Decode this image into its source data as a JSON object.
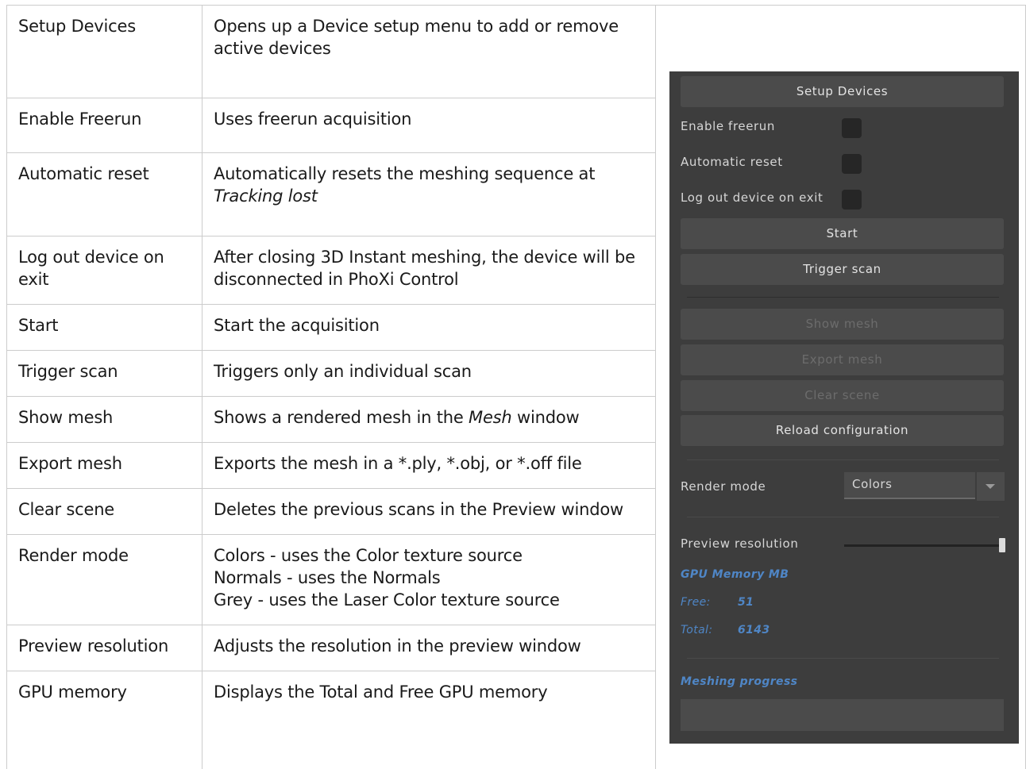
{
  "table": {
    "rows": [
      {
        "name": "Setup Devices",
        "desc": [
          "Opens up a Device setup menu to add or remove",
          "active devices"
        ]
      },
      {
        "name": "Enable Freerun",
        "desc": [
          "Uses freerun acquisition"
        ]
      },
      {
        "name": "Automatic reset",
        "desc_pre": "Automatically resets the meshing sequence at",
        "desc_italic": "Tracking lost"
      },
      {
        "name": "Log out device on exit",
        "desc": [
          "After closing 3D Instant meshing, the device will be",
          "disconnected in PhoXi Control"
        ]
      },
      {
        "name": "Start",
        "desc": [
          "Start the acquisition"
        ]
      },
      {
        "name": "Trigger scan",
        "desc": [
          "Triggers only an individual scan"
        ]
      },
      {
        "name": "Show mesh",
        "desc_pre": "Shows a rendered mesh in the ",
        "desc_italic": "Mesh",
        "desc_post": " window"
      },
      {
        "name": "Export mesh",
        "desc": [
          "Exports the mesh in a *.ply, *.obj, or *.off file"
        ]
      },
      {
        "name": "Clear scene",
        "desc": [
          "Deletes the previous scans in the Preview window"
        ]
      },
      {
        "name": "Render mode",
        "desc": [
          "Colors - uses the Color texture source",
          "Normals - uses the Normals",
          "Grey - uses the Laser Color texture source"
        ]
      },
      {
        "name": "Preview resolution",
        "desc": [
          "Adjusts the resolution in the preview window"
        ]
      },
      {
        "name": "GPU memory",
        "desc": [
          "Displays the Total and Free GPU memory"
        ]
      }
    ]
  },
  "panel": {
    "setup_devices": "Setup Devices",
    "enable_freerun": "Enable freerun",
    "automatic_reset": "Automatic reset",
    "logout_on_exit": "Log out device on exit",
    "start": "Start",
    "trigger_scan": "Trigger scan",
    "show_mesh": "Show mesh",
    "export_mesh": "Export mesh",
    "clear_scene": "Clear scene",
    "reload_configuration": "Reload configuration",
    "render_mode_label": "Render mode",
    "render_mode_value": "Colors",
    "preview_resolution_label": "Preview resolution",
    "preview_resolution_level": 1.0,
    "gpu_memory_title": "GPU Memory MB",
    "free_label": "Free:",
    "free_value": "51",
    "total_label": "Total:",
    "total_value": "6143",
    "meshing_progress_label": "Meshing progress",
    "colors": {
      "panel_bg": "#3d3d3d",
      "button_bg": "#4b4b4b",
      "accent_blue": "#4f86c6"
    }
  }
}
